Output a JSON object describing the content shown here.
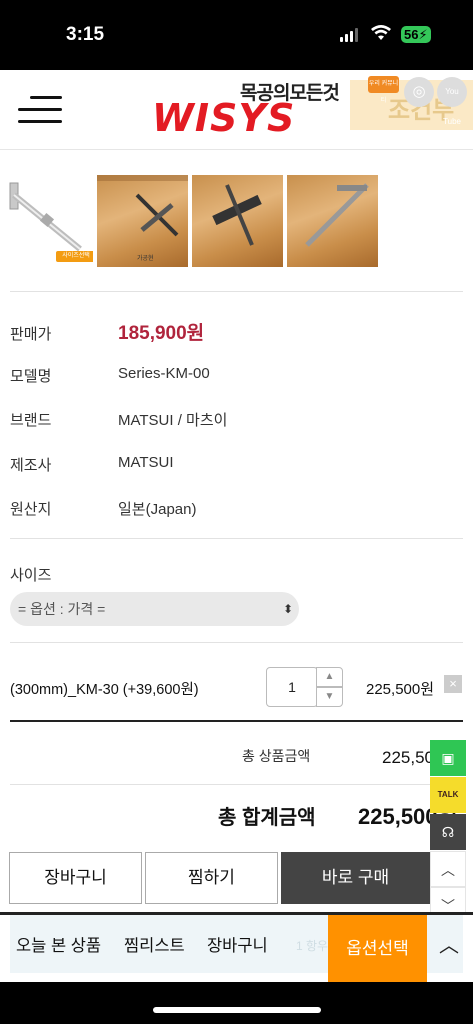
{
  "status_bar": {
    "time": "3:15",
    "battery": "56"
  },
  "header": {
    "logo_sub": "목공의모든것",
    "logo_main": "WISYS",
    "banner_text": "조건부",
    "badge_text": "우리 커뮤니티",
    "instagram_icon": "instagram-icon",
    "youtube_label": "You Tube"
  },
  "thumbnails": {
    "badge_label": "사이즈선택",
    "wood_label": "가공현"
  },
  "product_info": [
    {
      "label": "판매가",
      "value": "185,900원",
      "type": "price"
    },
    {
      "label": "모델명",
      "value": "Series-KM-00"
    },
    {
      "label": "브랜드",
      "value": "MATSUI / 마츠이"
    },
    {
      "label": "제조사",
      "value": "MATSUI"
    },
    {
      "label": "원산지",
      "value": "일본(Japan)"
    }
  ],
  "size": {
    "label": "사이즈",
    "select_value": "= 옵션 : 가격 ="
  },
  "selected_option": {
    "name": "(300mm)_KM-30 (+39,600원)",
    "quantity": "1",
    "price": "225,500원",
    "delete_icon": "×"
  },
  "totals": {
    "subtotal_label": "총 상품금액",
    "subtotal_value": "225,500원",
    "grand_label": "총 합계금액",
    "grand_value": "225,500원"
  },
  "buttons": {
    "cart": "장바구니",
    "wish": "찜하기",
    "buy": "바로 구매"
  },
  "side_float": {
    "talk": "TALK"
  },
  "bottom_bar": {
    "recent": "오늘 본 상품",
    "wishlist": "찜리스트",
    "cart": "장바구니",
    "ghost": "1 항우",
    "option_select": "옵션선택",
    "up_icon": "^"
  },
  "colors": {
    "price_red": "#b0243c",
    "logo_red": "#e31b23",
    "option_orange": "#ff9100",
    "buy_dark": "#444444"
  }
}
